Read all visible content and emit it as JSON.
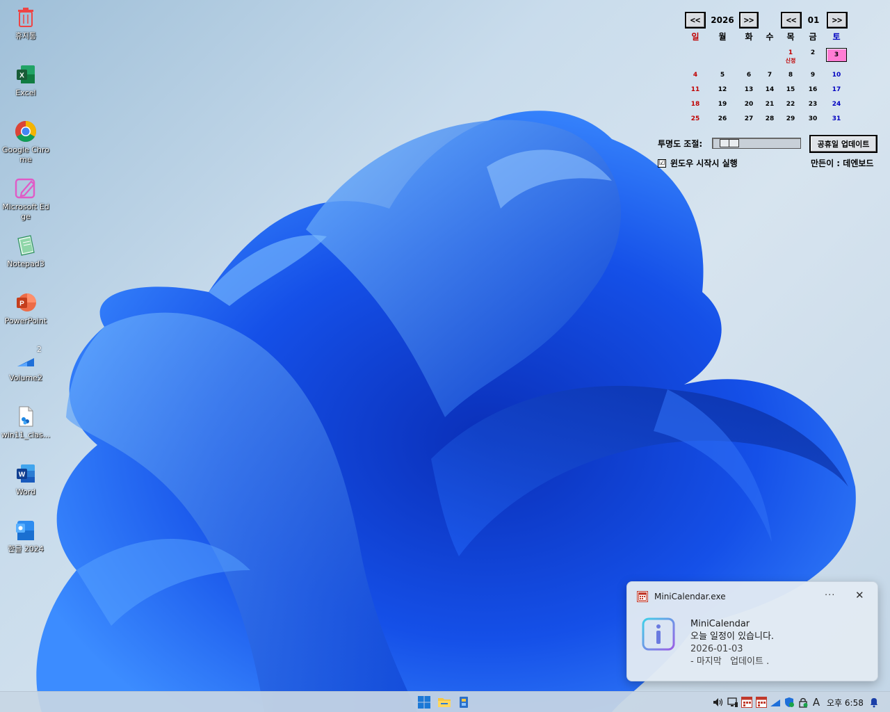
{
  "desktop": {
    "icons": [
      {
        "label": "휴지통",
        "icon": "recycle-bin-icon"
      },
      {
        "label": "Excel",
        "icon": "excel-icon"
      },
      {
        "label": "Google Chrome",
        "icon": "chrome-icon"
      },
      {
        "label": "Microsoft Edge",
        "icon": "edge-icon"
      },
      {
        "label": "Notepad3",
        "icon": "notepad3-icon"
      },
      {
        "label": "PowerPoint",
        "icon": "powerpoint-icon"
      },
      {
        "label": "Volume2",
        "icon": "volume2-icon",
        "badge": "2"
      },
      {
        "label": "win11_clas...",
        "icon": "file-icon"
      },
      {
        "label": "Word",
        "icon": "word-icon"
      },
      {
        "label": "한글 2024",
        "icon": "hangul-icon"
      }
    ]
  },
  "calendar": {
    "prev_year": "<<",
    "year": "2026",
    "next_year": ">>",
    "prev_month": "<<",
    "month": "01",
    "next_month": ">>",
    "weekdays": [
      "일",
      "월",
      "화",
      "수",
      "목",
      "금",
      "토"
    ],
    "weeks": [
      [
        "",
        "",
        "",
        "",
        "1",
        "2",
        "3"
      ],
      [
        "4",
        "5",
        "6",
        "7",
        "8",
        "9",
        "10"
      ],
      [
        "11",
        "12",
        "13",
        "14",
        "15",
        "16",
        "17"
      ],
      [
        "18",
        "19",
        "20",
        "21",
        "22",
        "23",
        "24"
      ],
      [
        "25",
        "26",
        "27",
        "28",
        "29",
        "30",
        "31"
      ]
    ],
    "holiday_label": "신정",
    "today": "3",
    "opacity_label": "투명도 조절:",
    "opacity_value": 0.1,
    "update_button": "공휴일 업데이트",
    "startup_label": "윈도우 시작시 실행",
    "startup_checked": "☑",
    "maker": "만든이 : 데엔보드",
    "colors": {
      "sunday": "#c00000",
      "saturday": "#0000c0",
      "today_bg": "#ff7dd4"
    }
  },
  "toast": {
    "app_name": "MiniCalendar.exe",
    "more": "···",
    "close": "✕",
    "title": "MiniCalendar",
    "message": "오늘 일정이 있습니다.",
    "date": "2026-01-03",
    "detail": "- 마지막   업데이트 ."
  },
  "taskbar": {
    "clock": "오후 6:58",
    "ime": "A"
  }
}
